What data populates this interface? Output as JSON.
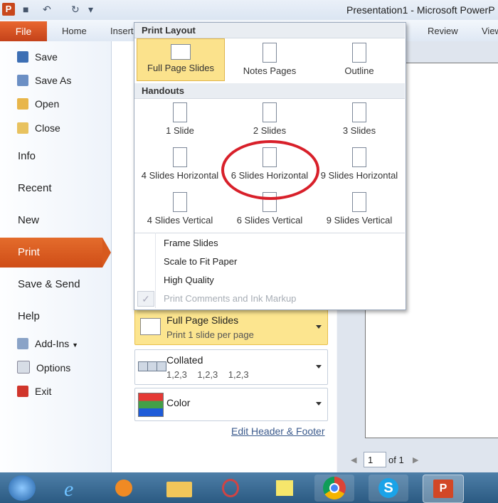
{
  "window": {
    "title": "Presentation1 - Microsoft PowerP"
  },
  "ribbon": {
    "file": "File",
    "tabs": [
      "Home",
      "Insert",
      "Review",
      "View"
    ]
  },
  "nav": {
    "save": "Save",
    "save_as": "Save As",
    "open": "Open",
    "close": "Close",
    "info": "Info",
    "recent": "Recent",
    "new": "New",
    "print": "Print",
    "save_send": "Save & Send",
    "help": "Help",
    "add_ins": "Add-Ins",
    "options": "Options",
    "exit": "Exit"
  },
  "dropdown": {
    "print_layout_header": "Print Layout",
    "layouts": {
      "full": "Full Page Slides",
      "notes": "Notes Pages",
      "outline": "Outline"
    },
    "handouts_header": "Handouts",
    "handouts": {
      "h1": "1 Slide",
      "h2": "2 Slides",
      "h3": "3 Slides",
      "h4h": "4 Slides Horizontal",
      "h6h": "6 Slides Horizontal",
      "h9h": "9 Slides Horizontal",
      "h4v": "4 Slides Vertical",
      "h6v": "6 Slides Vertical",
      "h9v": "9 Slides Vertical"
    },
    "options": {
      "frame": "Frame Slides",
      "scale": "Scale to Fit Paper",
      "quality": "High Quality",
      "comments": "Print Comments and Ink Markup"
    }
  },
  "settings": {
    "layout_title": "Full Page Slides",
    "layout_sub": "Print 1 slide per page",
    "collated_title": "Collated",
    "collated_sub": "1,2,3    1,2,3    1,2,3",
    "color": "Color",
    "edit_header": "Edit Header & Footer"
  },
  "pager": {
    "page": "1",
    "of": "of 1"
  },
  "colors": {
    "accent": "#d75a1e",
    "highlight": "#fbe28c",
    "circle": "#d8202a"
  }
}
